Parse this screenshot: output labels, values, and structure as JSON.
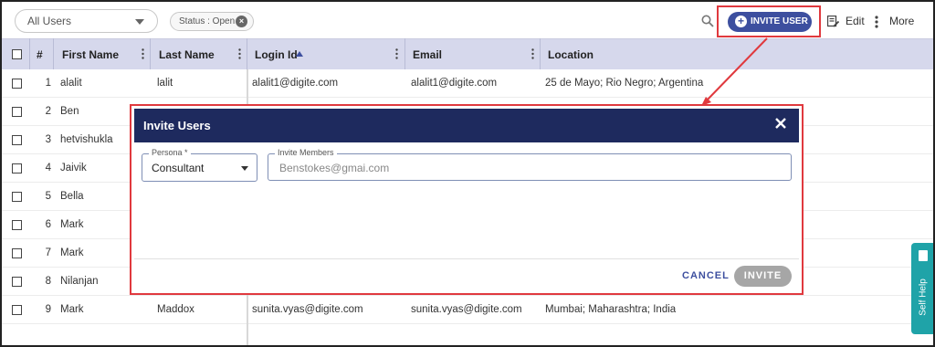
{
  "toolbar": {
    "users_filter": "All Users",
    "status_chip": "Status : Open",
    "invite_user_label": "INVITE USER",
    "edit_label": "Edit",
    "more_label": "More"
  },
  "table": {
    "headers": {
      "num": "#",
      "first_name": "First Name",
      "last_name": "Last Name",
      "login_id": "Login Id",
      "email": "Email",
      "location": "Location"
    },
    "rows": [
      {
        "num": "1",
        "first": "alalit",
        "last": "lalit",
        "login": "alalit1@digite.com",
        "email": "alalit1@digite.com",
        "location": "25 de Mayo; Rio Negro; Argentina"
      },
      {
        "num": "2",
        "first": "Ben",
        "last": "",
        "login": "",
        "email": "",
        "location": ""
      },
      {
        "num": "3",
        "first": "hetvishukla",
        "last": "",
        "login": "",
        "email": "",
        "location": ""
      },
      {
        "num": "4",
        "first": "Jaivik",
        "last": "",
        "login": "",
        "email": "",
        "location": ""
      },
      {
        "num": "5",
        "first": "Bella",
        "last": "",
        "login": "",
        "email": "",
        "location": ""
      },
      {
        "num": "6",
        "first": "Mark",
        "last": "",
        "login": "",
        "email": "",
        "location": ""
      },
      {
        "num": "7",
        "first": "Mark",
        "last": "",
        "login": "",
        "email": "",
        "location": ""
      },
      {
        "num": "8",
        "first": "Nilanjan",
        "last": "",
        "login": "",
        "email": "",
        "location": ""
      },
      {
        "num": "9",
        "first": "Mark",
        "last": "Maddox",
        "login": "sunita.vyas@digite.com",
        "email": "sunita.vyas@digite.com",
        "location": "Mumbai; Maharashtra; India"
      }
    ]
  },
  "modal": {
    "title": "Invite Users",
    "persona_label": "Persona *",
    "persona_value": "Consultant",
    "members_label": "Invite Members",
    "members_placeholder": "Benstokes@gmai.com",
    "cancel_label": "CANCEL",
    "invite_label": "INVITE"
  },
  "self_help": {
    "label": "Self Help"
  },
  "colors": {
    "header_bg": "#d6d8ec",
    "modal_header": "#1e2a5e",
    "primary": "#3d4f9f",
    "highlight": "#e0393e",
    "self_help": "#1fa3a8"
  }
}
